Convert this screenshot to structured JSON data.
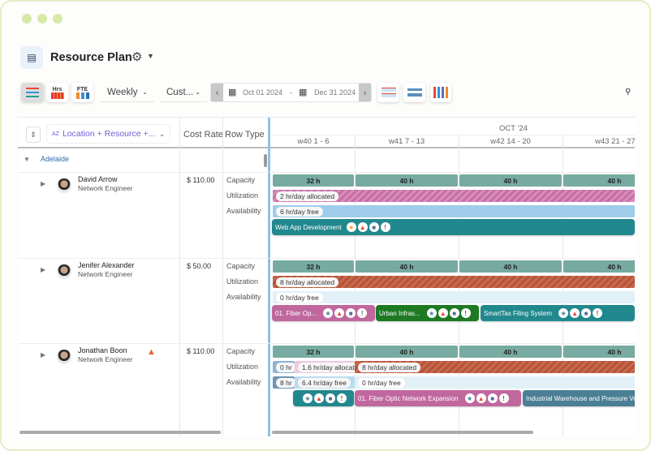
{
  "window": {
    "dots": 3
  },
  "header": {
    "title": "Resource Plan"
  },
  "toolbar": {
    "view_gantt": "gantt-view",
    "hrs": "Hrs",
    "fte": "FTE",
    "period": "Weekly",
    "range": "Cust...",
    "start_date": "Oct 01 2024",
    "date_sep": "-",
    "end_date": "Dec 31 2024",
    "prev": "‹",
    "next": "›"
  },
  "grid": {
    "group_by": "Location + Resource +...",
    "columns": {
      "cost_rate": "Cost Rate",
      "row_type": "Row Type"
    },
    "month": "OCT '24",
    "weeks": [
      "w40 1 - 6",
      "w41 7 - 13",
      "w42 14 - 20",
      "w43 21 - 27"
    ],
    "group": "Adelaide",
    "row_types": [
      "Capacity",
      "Utilization",
      "Availability"
    ],
    "resources": [
      {
        "name": "David Arrow",
        "role": "Network Engineer",
        "cost": "$ 110.00",
        "capacity": [
          "32 h",
          "40 h",
          "40 h",
          "40 h"
        ],
        "utilization": [
          "2 hr/day allocated"
        ],
        "availability": [
          "6 hr/day free"
        ],
        "tasks": [
          "Web App Development"
        ]
      },
      {
        "name": "Jenifer Alexander",
        "role": "Network Engineer",
        "cost": "$ 50.00",
        "capacity": [
          "32 h",
          "40 h",
          "40 h",
          "40 h"
        ],
        "utilization": [
          "8 hr/day allocated"
        ],
        "availability": [
          "0 hr/day free"
        ],
        "tasks": [
          "01. Fiber Op...",
          "Urban Infras...",
          "SmartTax Filing System"
        ]
      },
      {
        "name": "Jonathan Boon",
        "role": "Network Engineer",
        "cost": "$ 110.00",
        "warning": true,
        "capacity": [
          "32 h",
          "40 h",
          "40 h",
          "40 h"
        ],
        "utilization": [
          "0 hr",
          "1.6 hr/day allocat",
          "8 hr/day allocated"
        ],
        "availability": [
          "8 hr",
          "6.4 hr/day free",
          "0 hr/day free"
        ],
        "tasks": [
          "",
          "01. Fiber Optic Network Expansion",
          "Industrial Warehouse and Pressure Vessel"
        ]
      }
    ]
  },
  "colors": {
    "capacity": "#77aba1",
    "pink": "#c0679e",
    "teal": "#21888e",
    "green": "#1d7a23",
    "rust": "#b4553a",
    "avail": "#b9dcef",
    "frame": "#e3eec4"
  }
}
